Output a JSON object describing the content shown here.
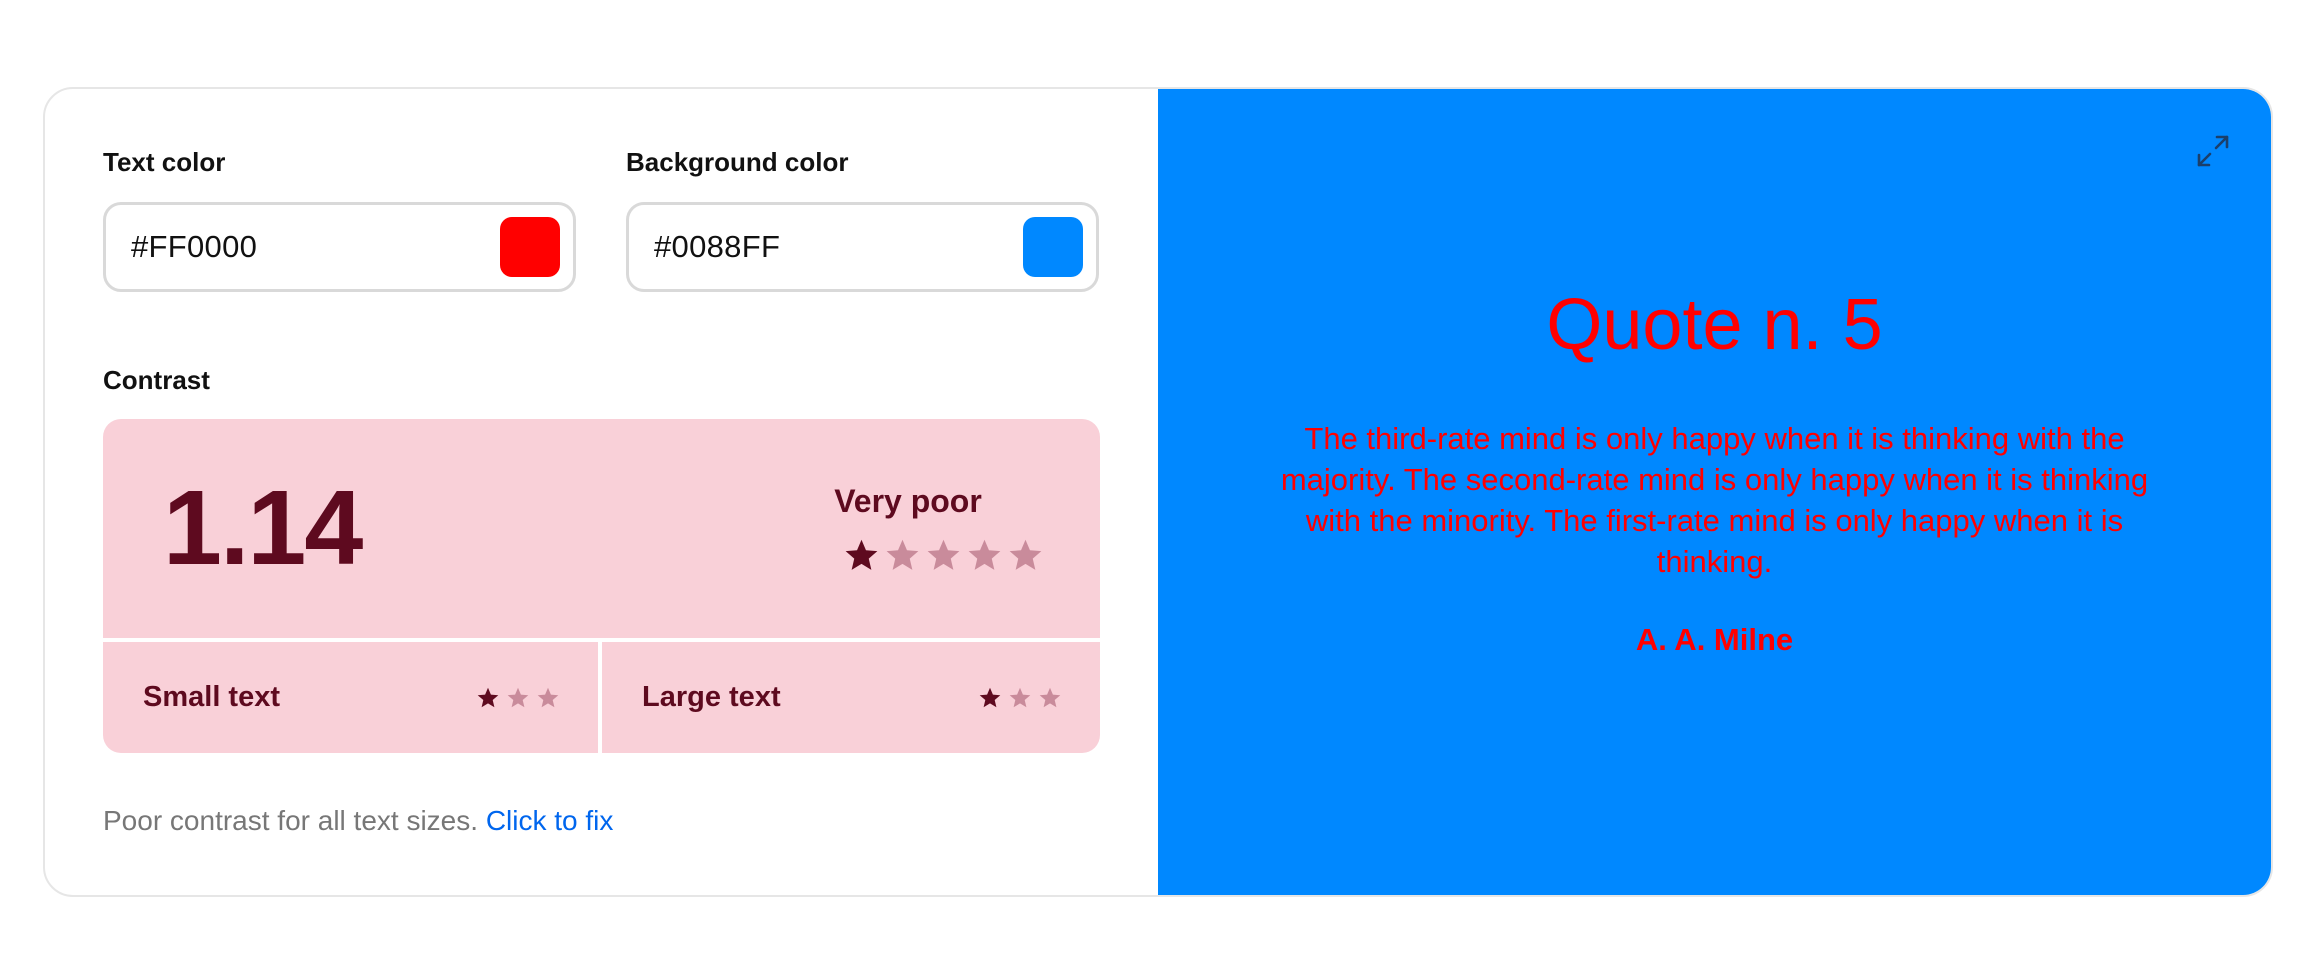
{
  "text_color": {
    "label": "Text color",
    "value": "#FF0000",
    "swatch": "#FF0000"
  },
  "background_color": {
    "label": "Background color",
    "value": "#0088FF",
    "swatch": "#0088FF"
  },
  "contrast": {
    "label": "Contrast",
    "ratio": "1.14",
    "rating_text": "Very poor",
    "rating_stars": 1,
    "rating_max": 5,
    "small_text": {
      "label": "Small text",
      "stars": 1,
      "max": 3
    },
    "large_text": {
      "label": "Large text",
      "stars": 1,
      "max": 3
    },
    "colors": {
      "background": "#F9D0D8",
      "foreground": "#5E0A1F",
      "star_empty": "#C98B9B"
    }
  },
  "footer": {
    "message": "Poor contrast for all text sizes.",
    "fix_link": "Click to fix"
  },
  "preview": {
    "title": "Quote n. 5",
    "text": "The third-rate mind is only happy when it is thinking with the majority. The second-rate mind is only happy when it is thinking with the minority. The first-rate mind is only happy when it is thinking.",
    "author": "A. A. Milne",
    "expand_icon": "expand-icon"
  }
}
